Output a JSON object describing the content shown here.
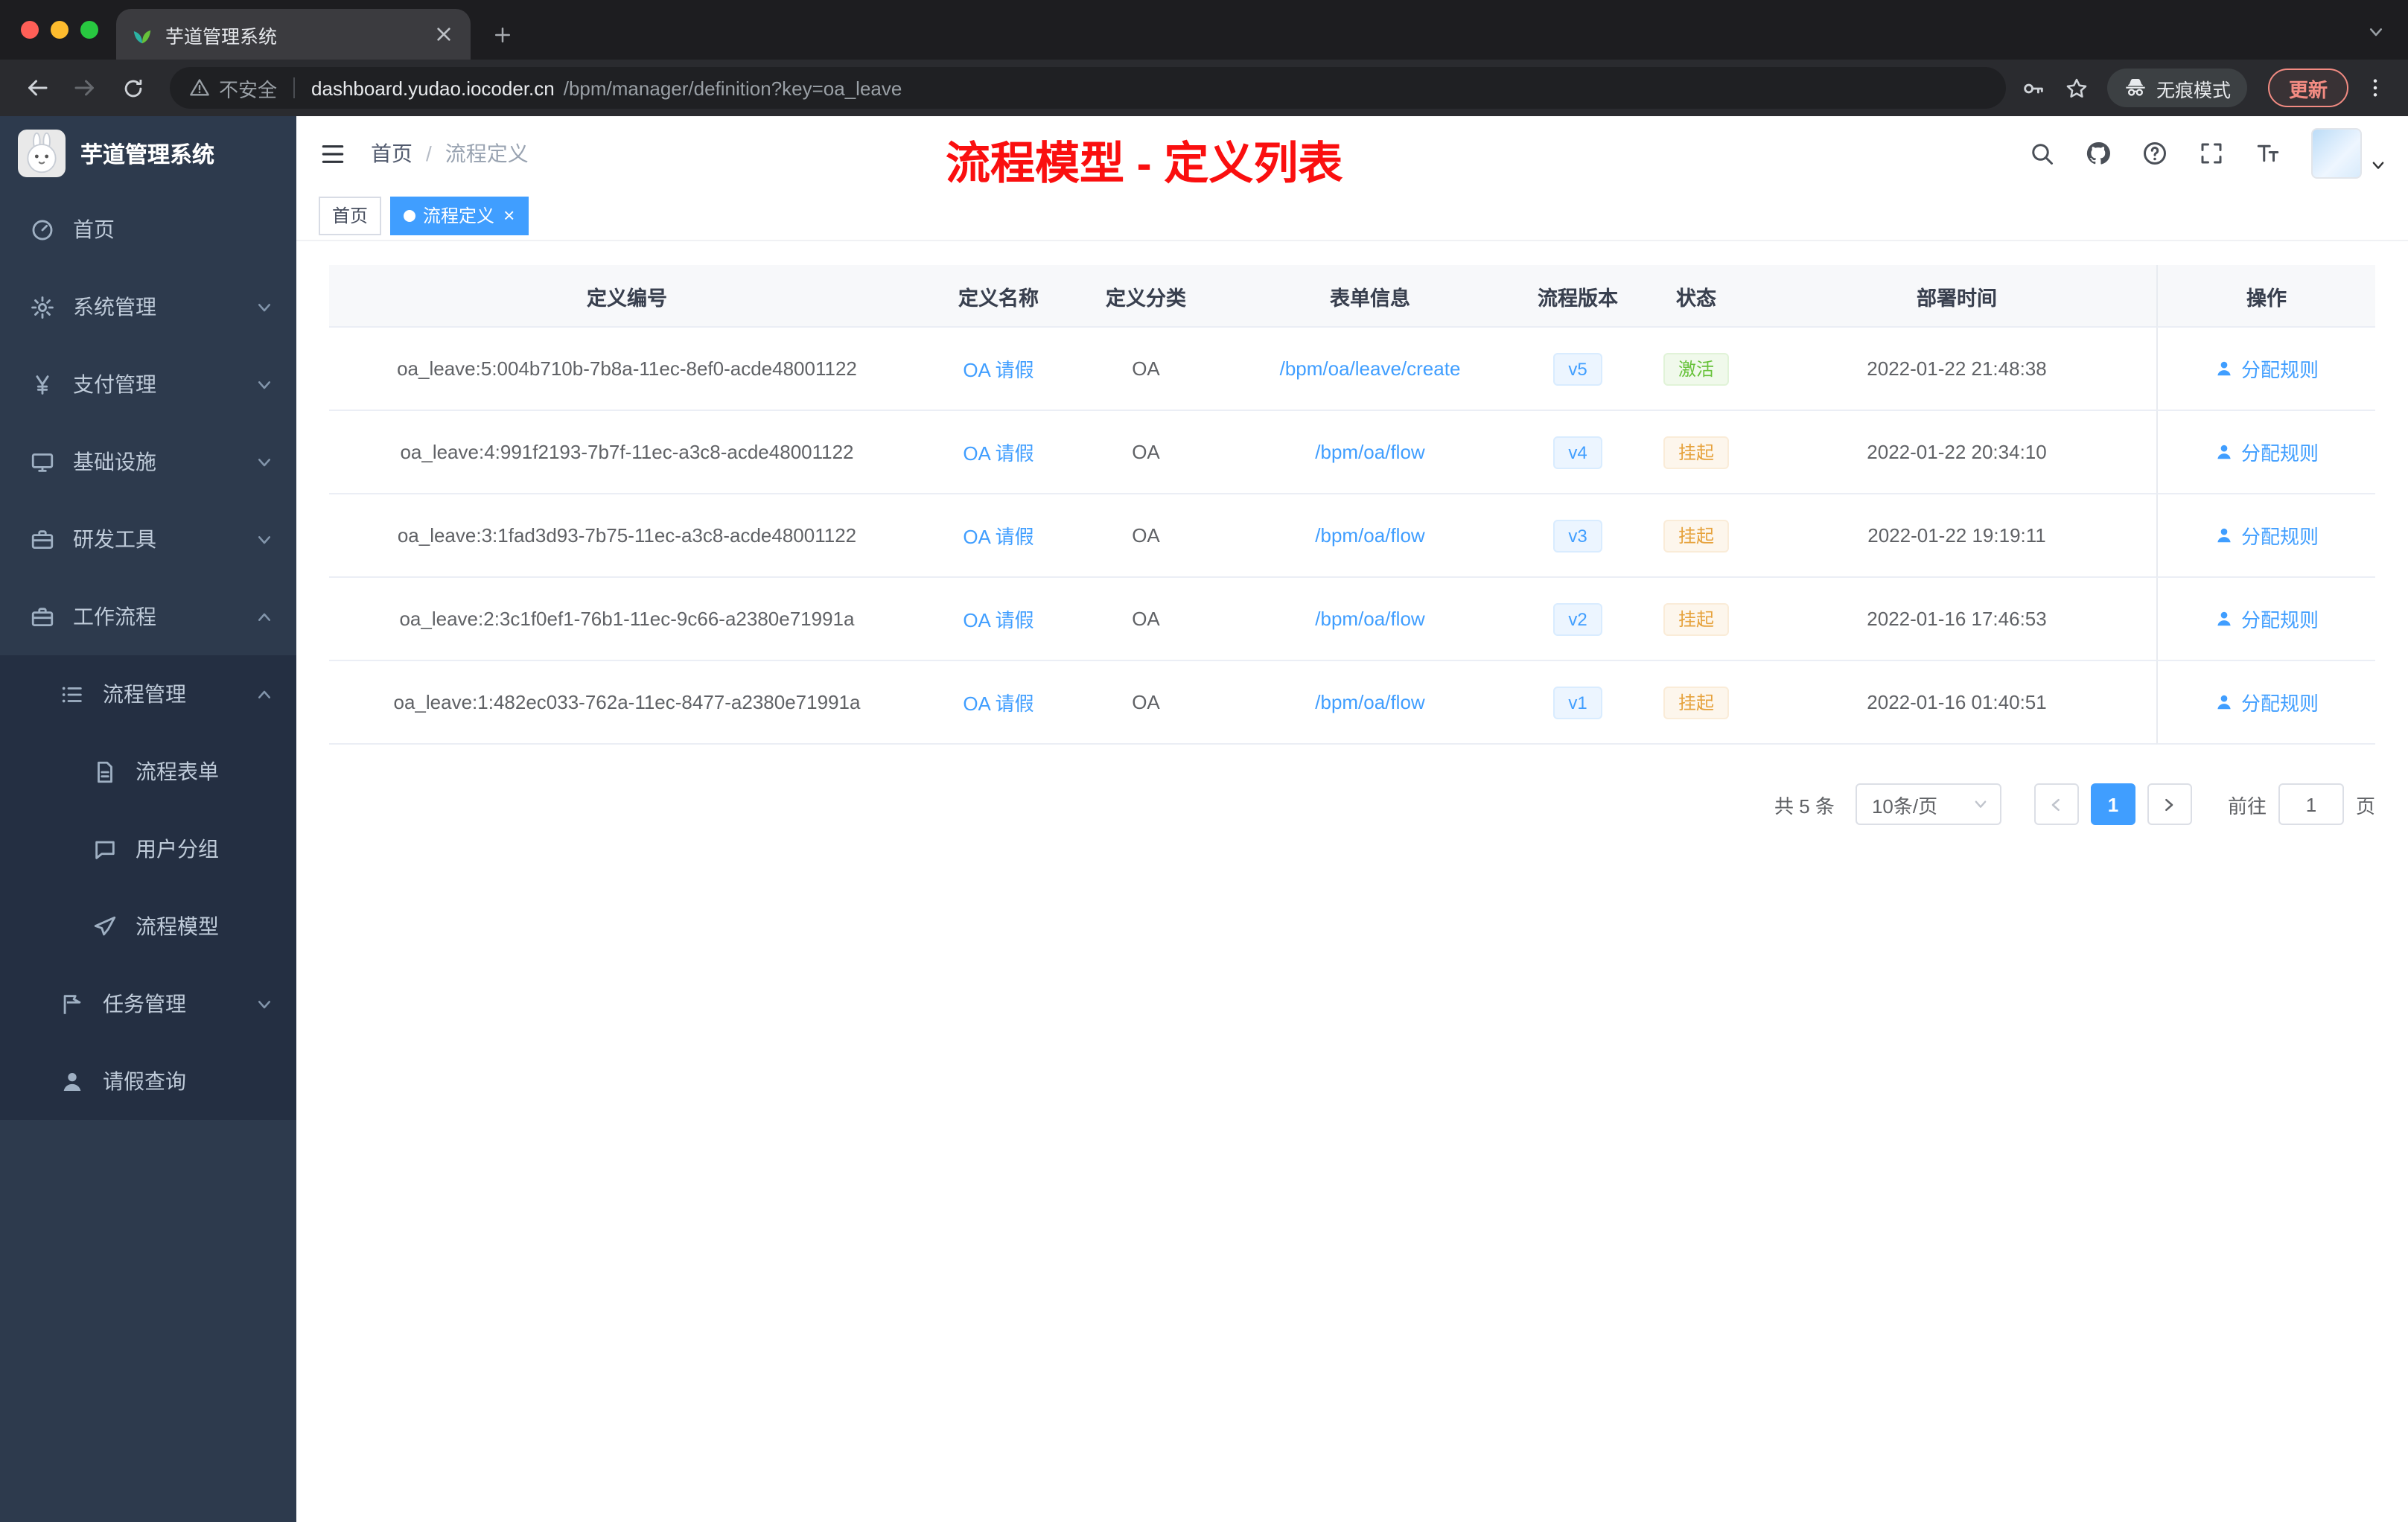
{
  "browser": {
    "tab": {
      "title": "芋道管理系统"
    },
    "address": {
      "security": "不安全",
      "domain": "dashboard.yudao.iocoder.cn",
      "path": "/bpm/manager/definition?key=oa_leave"
    },
    "incognito_label": "无痕模式",
    "update_label": "更新"
  },
  "icons": {
    "tab_favicon": "leaf-icon",
    "security": "warning-triangle-icon",
    "address_right": [
      "key-icon",
      "star-icon"
    ],
    "incognito": "incognito-icon",
    "menu_icons": [
      "gauge-icon",
      "gear-icon",
      "yen-icon",
      "monitor-icon",
      "toolbox-icon",
      "briefcase-icon",
      "list-icon",
      "document-icon",
      "chat-icon",
      "paper-plane-icon",
      "flag-icon",
      "user-icon"
    ],
    "header_icons": [
      "fold-icon",
      "search-icon",
      "github-icon",
      "question-icon",
      "fullscreen-icon",
      "font-size-icon"
    ],
    "action_icon": "user-icon",
    "yen_glyph": "¥"
  },
  "sidebar": {
    "app_title": "芋道管理系统",
    "items": [
      {
        "label": "首页"
      },
      {
        "label": "系统管理"
      },
      {
        "label": "支付管理"
      },
      {
        "label": "基础设施"
      },
      {
        "label": "研发工具"
      },
      {
        "label": "工作流程"
      },
      {
        "label": "流程管理"
      },
      {
        "label": "流程表单"
      },
      {
        "label": "用户分组"
      },
      {
        "label": "流程模型"
      },
      {
        "label": "任务管理"
      },
      {
        "label": "请假查询"
      }
    ]
  },
  "header": {
    "breadcrumb": {
      "home": "首页",
      "separator": "/",
      "current": "流程定义"
    },
    "annotation": "流程模型 - 定义列表"
  },
  "tags": {
    "items": [
      {
        "label": "首页"
      },
      {
        "label": "流程定义"
      }
    ],
    "close": "×"
  },
  "table": {
    "columns": {
      "id": "定义编号",
      "name": "定义名称",
      "category": "定义分类",
      "form": "表单信息",
      "version": "流程版本",
      "status": "状态",
      "time": "部署时间",
      "action": "操作"
    },
    "rows": [
      {
        "id": "oa_leave:5:004b710b-7b8a-11ec-8ef0-acde48001122",
        "name": "OA 请假",
        "category": "OA",
        "form": "/bpm/oa/leave/create",
        "version": "v5",
        "status": "激活",
        "time": "2022-01-22 21:48:38",
        "action": "分配规则"
      },
      {
        "id": "oa_leave:4:991f2193-7b7f-11ec-a3c8-acde48001122",
        "name": "OA 请假",
        "category": "OA",
        "form": "/bpm/oa/flow",
        "version": "v4",
        "status": "挂起",
        "time": "2022-01-22 20:34:10",
        "action": "分配规则"
      },
      {
        "id": "oa_leave:3:1fad3d93-7b75-11ec-a3c8-acde48001122",
        "name": "OA 请假",
        "category": "OA",
        "form": "/bpm/oa/flow",
        "version": "v3",
        "status": "挂起",
        "time": "2022-01-22 19:19:11",
        "action": "分配规则"
      },
      {
        "id": "oa_leave:2:3c1f0ef1-76b1-11ec-9c66-a2380e71991a",
        "name": "OA 请假",
        "category": "OA",
        "form": "/bpm/oa/flow",
        "version": "v2",
        "status": "挂起",
        "time": "2022-01-16 17:46:53",
        "action": "分配规则"
      },
      {
        "id": "oa_leave:1:482ec033-762a-11ec-8477-a2380e71991a",
        "name": "OA 请假",
        "category": "OA",
        "form": "/bpm/oa/flow",
        "version": "v1",
        "status": "挂起",
        "time": "2022-01-16 01:40:51",
        "action": "分配规则"
      }
    ]
  },
  "pagination": {
    "total": "共 5 条",
    "page_size": "10条/页",
    "page": "1",
    "goto": "前往",
    "goto_value": "1",
    "unit": "页"
  }
}
